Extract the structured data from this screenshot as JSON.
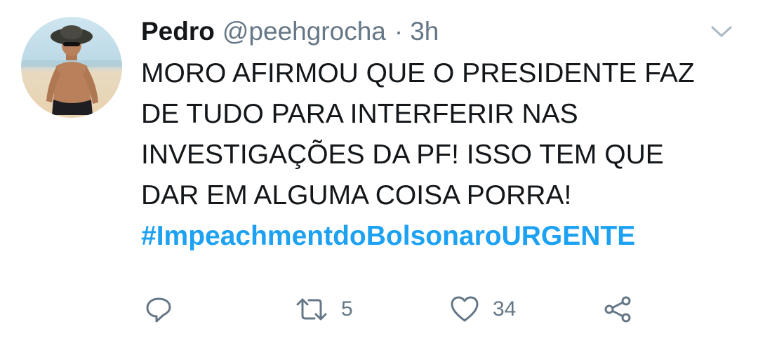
{
  "tweet": {
    "display_name": "Pedro",
    "handle": "@peehgrocha",
    "separator": "·",
    "time_ago": "3h",
    "text_lines": [
      "MORO AFIRMOU QUE O PRESIDENTE FAZ",
      "DE TUDO PARA INTERFERIR NAS",
      "INVESTIGAÇÕES DA PF! ISSO TEM QUE",
      "DAR EM ALGUMA COISA PORRA!"
    ],
    "hashtag": "#ImpeachmentdoBolsonaroURGENTE"
  },
  "actions": {
    "reply_icon": "reply-icon",
    "retweet_icon": "retweet-icon",
    "retweet_count": "5",
    "like_icon": "heart-icon",
    "like_count": "34",
    "share_icon": "share-icon"
  },
  "colors": {
    "text": "#14171a",
    "secondary": "#657786",
    "link": "#1da1f2"
  }
}
